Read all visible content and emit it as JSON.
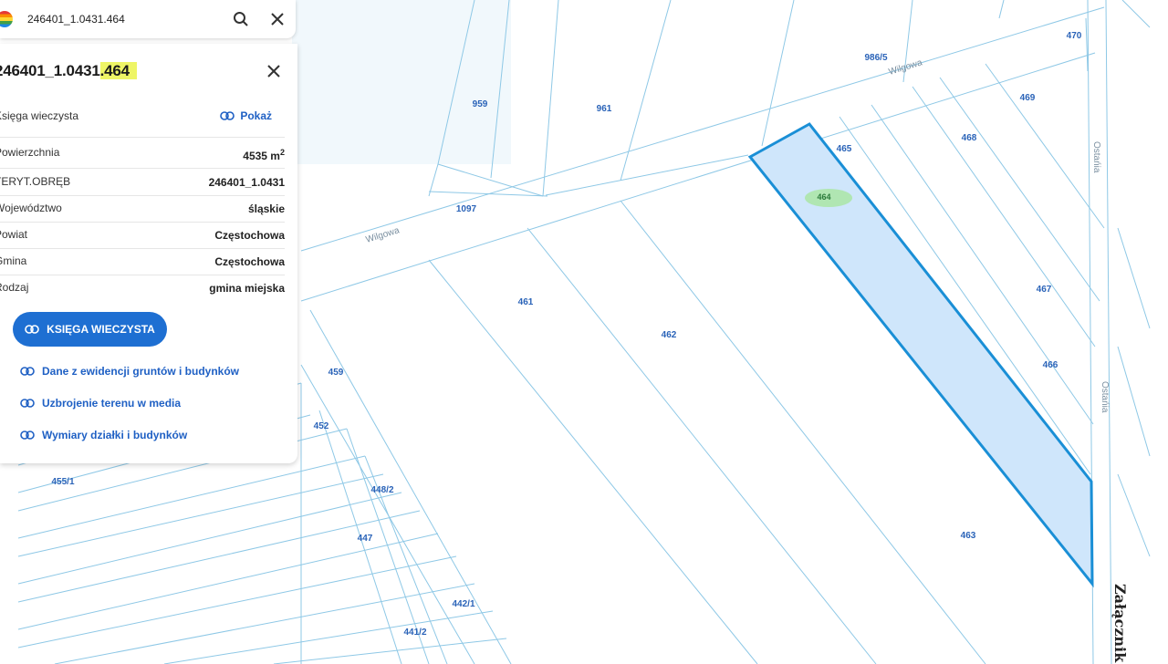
{
  "search": {
    "value": "246401_1.0431.464"
  },
  "panel": {
    "title_prefix": "246401_1.0431",
    "title_highlight": ".464",
    "rows": [
      {
        "label": "Księga wieczysta",
        "value": "Pokaż"
      },
      {
        "label": "Powierzchnia",
        "value": "4535 m",
        "sup": "2"
      },
      {
        "label": "TERYT.OBRĘB",
        "value": "246401_1.0431"
      },
      {
        "label": "Województwo",
        "value": "śląskie"
      },
      {
        "label": "Powiat",
        "value": "Częstochowa"
      },
      {
        "label": "Gmina",
        "value": "Częstochowa"
      },
      {
        "label": "Rodzaj",
        "value": "gmina miejska"
      }
    ],
    "button_label": "KSIĘGA WIECZYSTA",
    "links": [
      "Dane z ewidencji gruntów i budynków",
      "Uzbrojenie terenu w media",
      "Wymiary działki i budynków"
    ]
  },
  "map": {
    "parcels": [
      "959",
      "961",
      "986/5",
      "470",
      "469",
      "468",
      "465",
      "464",
      "1097",
      "461",
      "462",
      "467",
      "466",
      "463",
      "459",
      "452",
      "455/1",
      "448/2",
      "447",
      "442/1",
      "441/2"
    ],
    "streets": [
      "Wilgowa",
      "Wilgowa",
      "Ostańia",
      "Ostańia"
    ],
    "stamp": "Załącznik nr",
    "selected_color": "#1a8fd6",
    "selected_fill": "#cfe6fb"
  }
}
